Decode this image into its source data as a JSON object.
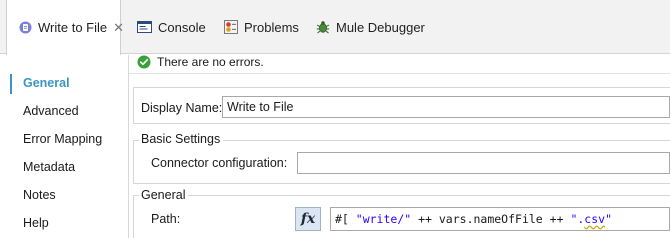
{
  "tabs": [
    {
      "label": "Write to File",
      "icon": "file-connector-icon",
      "active": true,
      "closable": true
    },
    {
      "label": "Console",
      "icon": "console-icon",
      "active": false
    },
    {
      "label": "Problems",
      "icon": "problems-icon",
      "active": false
    },
    {
      "label": "Mule Debugger",
      "icon": "debugger-bug-icon",
      "active": false
    }
  ],
  "tab_close_glyph": "✕",
  "nav": {
    "items": [
      {
        "label": "General",
        "active": true
      },
      {
        "label": "Advanced"
      },
      {
        "label": "Error Mapping"
      },
      {
        "label": "Metadata"
      },
      {
        "label": "Notes"
      },
      {
        "label": "Help"
      }
    ],
    "accent_color": "#3a95c4"
  },
  "status": {
    "text": "There are no errors.",
    "icon": "check-circle-icon",
    "color": "#3aa03a"
  },
  "display_name": {
    "label": "Display Name:",
    "value": "Write to File"
  },
  "basic_settings": {
    "title": "Basic Settings",
    "connector_label": "Connector configuration:",
    "connector_value": ""
  },
  "general": {
    "title": "General",
    "path_label": "Path:",
    "fx_label": "fx",
    "expression": {
      "prefix": "#[ ",
      "str1": "\"write/\"",
      "op1": " ++ ",
      "var": "vars.nameOfFile",
      "op2": " ++ ",
      "str2_open": "\".",
      "str2_csv": "csv",
      "str2_close": "\""
    }
  }
}
